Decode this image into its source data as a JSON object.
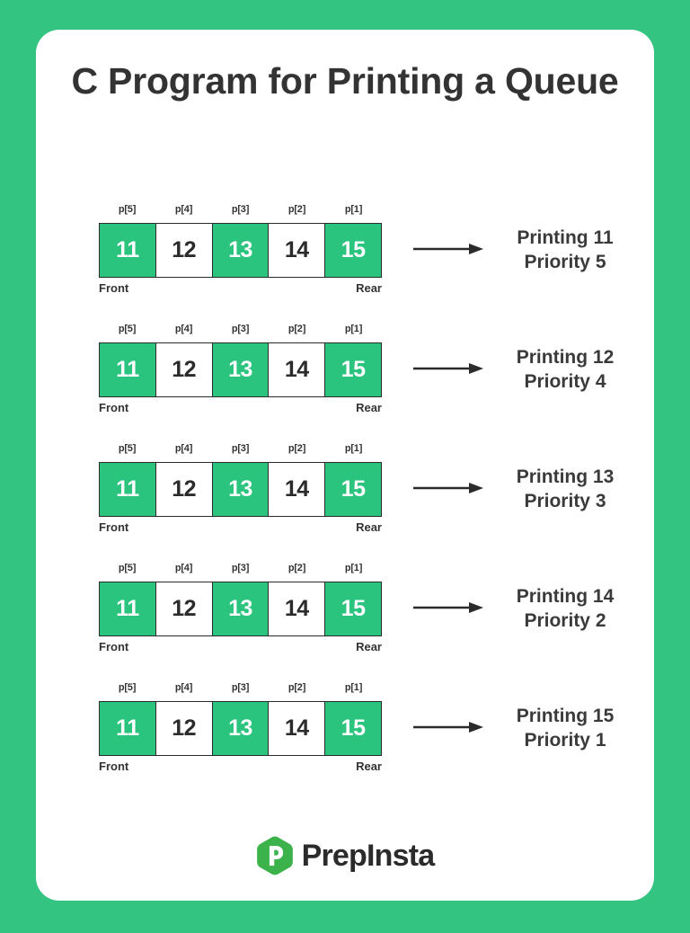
{
  "page": {
    "background_color": "#34C481",
    "card_color": "#ffffff",
    "accent_green": "#2BC47E",
    "text_color": "#333333"
  },
  "title": "C Program for Printing a Queue",
  "queue": {
    "index_labels": [
      "p[5]",
      "p[4]",
      "p[3]",
      "p[2]",
      "p[1]"
    ],
    "values": [
      "11",
      "12",
      "13",
      "14",
      "15"
    ],
    "fills": [
      "green",
      "white",
      "green",
      "white",
      "green"
    ],
    "front_label": "Front",
    "rear_label": "Rear"
  },
  "rows": [
    {
      "output_line1": "Printing 11",
      "output_line2": "Priority 5"
    },
    {
      "output_line1": "Printing 12",
      "output_line2": "Priority 4"
    },
    {
      "output_line1": "Printing 13",
      "output_line2": "Priority 3"
    },
    {
      "output_line1": "Printing 14",
      "output_line2": "Priority 2"
    },
    {
      "output_line1": "Printing 15",
      "output_line2": "Priority 1"
    }
  ],
  "footer": {
    "logo_text": "PrepInsta",
    "logo_letter": "P",
    "logo_color": "#3BB24A"
  }
}
